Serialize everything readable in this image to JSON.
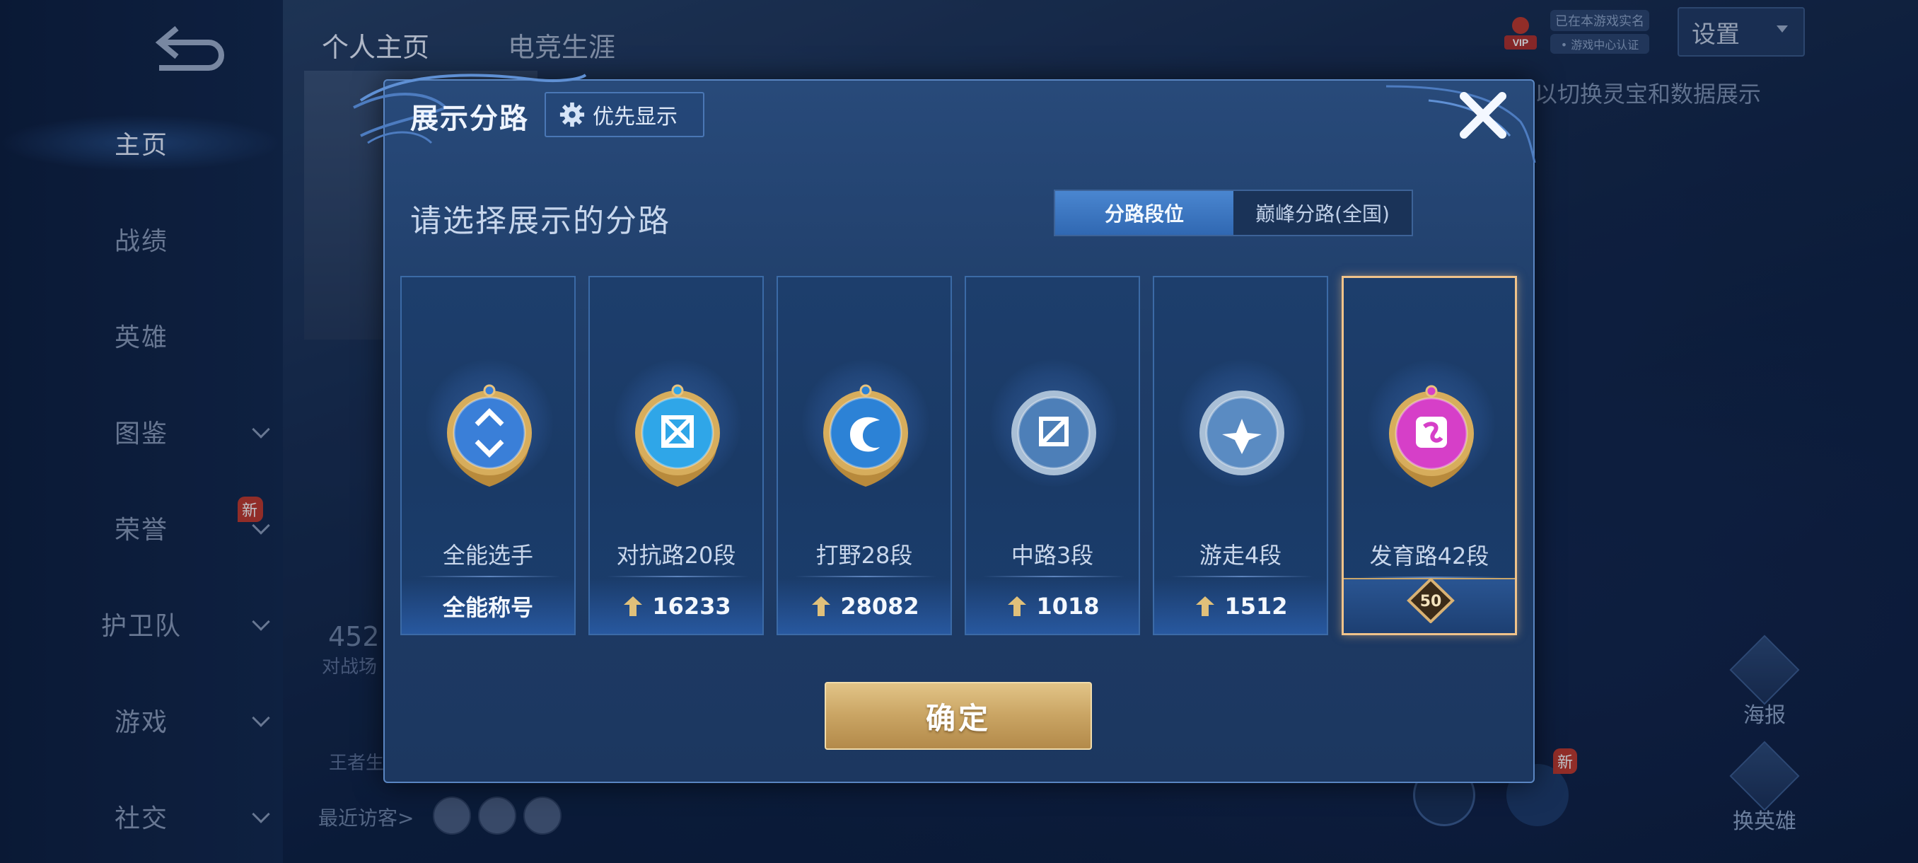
{
  "sidebar": {
    "items": [
      {
        "label": "主页",
        "active": true,
        "chevron": false
      },
      {
        "label": "战绩",
        "active": false,
        "chevron": false
      },
      {
        "label": "英雄",
        "active": false,
        "chevron": false
      },
      {
        "label": "图鉴",
        "active": false,
        "chevron": true
      },
      {
        "label": "荣誉",
        "active": false,
        "chevron": true,
        "badge": "新"
      },
      {
        "label": "护卫队",
        "active": false,
        "chevron": true
      },
      {
        "label": "游戏",
        "active": false,
        "chevron": true
      },
      {
        "label": "社交",
        "active": false,
        "chevron": true
      }
    ]
  },
  "top_tabs": [
    {
      "label": "个人主页",
      "active": true
    },
    {
      "label": "电竞生涯",
      "active": false
    }
  ],
  "top_right": {
    "vip_label": "VIP",
    "vip_tag1": "已在本游戏实名",
    "vip_tag2": "• 游戏中心认证",
    "settings_label": "设置",
    "hint": "以切换灵宝和数据展示"
  },
  "background": {
    "stat_number": "452",
    "stat_label": "对战场",
    "wangzhe_label": "王者生",
    "recent_visitors": "最近访客>",
    "right_buttons": [
      "海报",
      "换英雄"
    ],
    "bottom_new_badge": "新"
  },
  "modal": {
    "title": "展示分路",
    "priority_label": "优先显示",
    "subtitle": "请选择展示的分路",
    "segment": [
      {
        "label": "分路段位",
        "active": true
      },
      {
        "label": "巅峰分路(全国)",
        "active": false
      }
    ],
    "cards": [
      {
        "name": "全能选手",
        "footer": "全能称号",
        "points": null,
        "selected": false,
        "emblem": "all-round",
        "tone": "#3a7fd8"
      },
      {
        "name": "对抗路20段",
        "footer": "16233",
        "points": true,
        "selected": false,
        "emblem": "clash-lane",
        "tone": "#2fa6e8"
      },
      {
        "name": "打野28段",
        "footer": "28082",
        "points": true,
        "selected": false,
        "emblem": "jungle",
        "tone": "#2c82d6"
      },
      {
        "name": "中路3段",
        "footer": "1018",
        "points": true,
        "selected": false,
        "emblem": "mid-lane",
        "tone": "#4d7fb8"
      },
      {
        "name": "游走4段",
        "footer": "1512",
        "points": true,
        "selected": false,
        "emblem": "roam",
        "tone": "#5a8bc2"
      },
      {
        "name": "发育路42段",
        "footer": "50",
        "points": false,
        "selected": true,
        "emblem": "farm-lane",
        "tone": "#d63fc8"
      }
    ],
    "confirm_label": "确定"
  },
  "colors": {
    "accent_gold": "#d8b674",
    "selected_border": "#f0c38a",
    "modal_bg": "#234472"
  }
}
